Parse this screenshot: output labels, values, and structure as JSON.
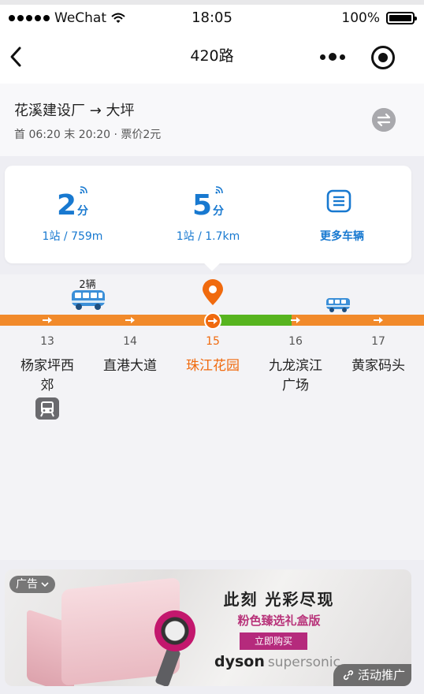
{
  "status_bar": {
    "carrier": "WeChat",
    "time": "18:05",
    "battery": "100%"
  },
  "nav": {
    "title": "420路"
  },
  "route": {
    "name": "花溪建设厂 → 大坪",
    "meta": "首 06:20 末 20:20 · 票价2元"
  },
  "arrivals": [
    {
      "minutes": "2",
      "unit": "分",
      "detail": "1站 / 759m"
    },
    {
      "minutes": "5",
      "unit": "分",
      "detail": "1站 / 1.7km"
    }
  ],
  "more_vehicles_label": "更多车辆",
  "line": {
    "bus_count_label": "2辆",
    "stops": [
      {
        "num": "13",
        "name": "杨家坪西郊"
      },
      {
        "num": "14",
        "name": "直港大道"
      },
      {
        "num": "15",
        "name": "珠江花园",
        "current": true
      },
      {
        "num": "16",
        "name": "九龙滨江广场"
      },
      {
        "num": "17",
        "name": "黄家码头"
      }
    ],
    "colors": {
      "traveled": "#f18a2b",
      "clear": "#57b41f",
      "current": "#f06a0e",
      "link": "#1879d0"
    }
  },
  "ad": {
    "badge": "广告",
    "headline": "此刻 光彩尽现",
    "subheadline": "粉色臻选礼盒版",
    "cta": "立即购买",
    "brand": "dyson",
    "product": "supersonic",
    "promo": "活动推广"
  }
}
